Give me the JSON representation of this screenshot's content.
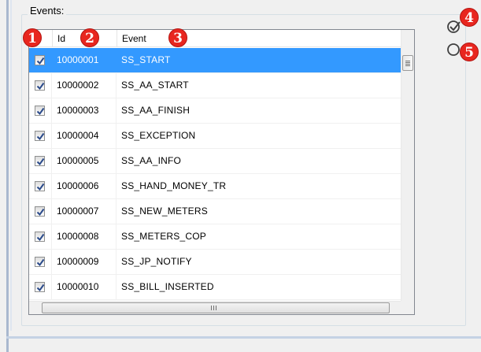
{
  "group": {
    "label": "Events:"
  },
  "columns": {
    "id": "Id",
    "event": "Event"
  },
  "events": [
    {
      "id": "10000001",
      "event": "SS_START",
      "checked": true,
      "selected": true
    },
    {
      "id": "10000002",
      "event": "SS_AA_START",
      "checked": true,
      "selected": false
    },
    {
      "id": "10000003",
      "event": "SS_AA_FINISH",
      "checked": true,
      "selected": false
    },
    {
      "id": "10000004",
      "event": "SS_EXCEPTION",
      "checked": true,
      "selected": false
    },
    {
      "id": "10000005",
      "event": "SS_AA_INFO",
      "checked": true,
      "selected": false
    },
    {
      "id": "10000006",
      "event": "SS_HAND_MONEY_TR",
      "checked": true,
      "selected": false
    },
    {
      "id": "10000007",
      "event": "SS_NEW_METERS",
      "checked": true,
      "selected": false
    },
    {
      "id": "10000008",
      "event": "SS_METERS_COP",
      "checked": true,
      "selected": false
    },
    {
      "id": "10000009",
      "event": "SS_JP_NOTIFY",
      "checked": true,
      "selected": false
    },
    {
      "id": "10000010",
      "event": "SS_BILL_INSERTED",
      "checked": true,
      "selected": false
    }
  ],
  "badges": [
    "1",
    "2",
    "3",
    "4",
    "5"
  ],
  "side_buttons": [
    {
      "icon": "check-all-icon"
    },
    {
      "icon": "uncheck-all-icon"
    }
  ],
  "colors": {
    "selection": "#3399ff",
    "badge": "#e8261f",
    "checkmark": "#2a4a8a"
  }
}
